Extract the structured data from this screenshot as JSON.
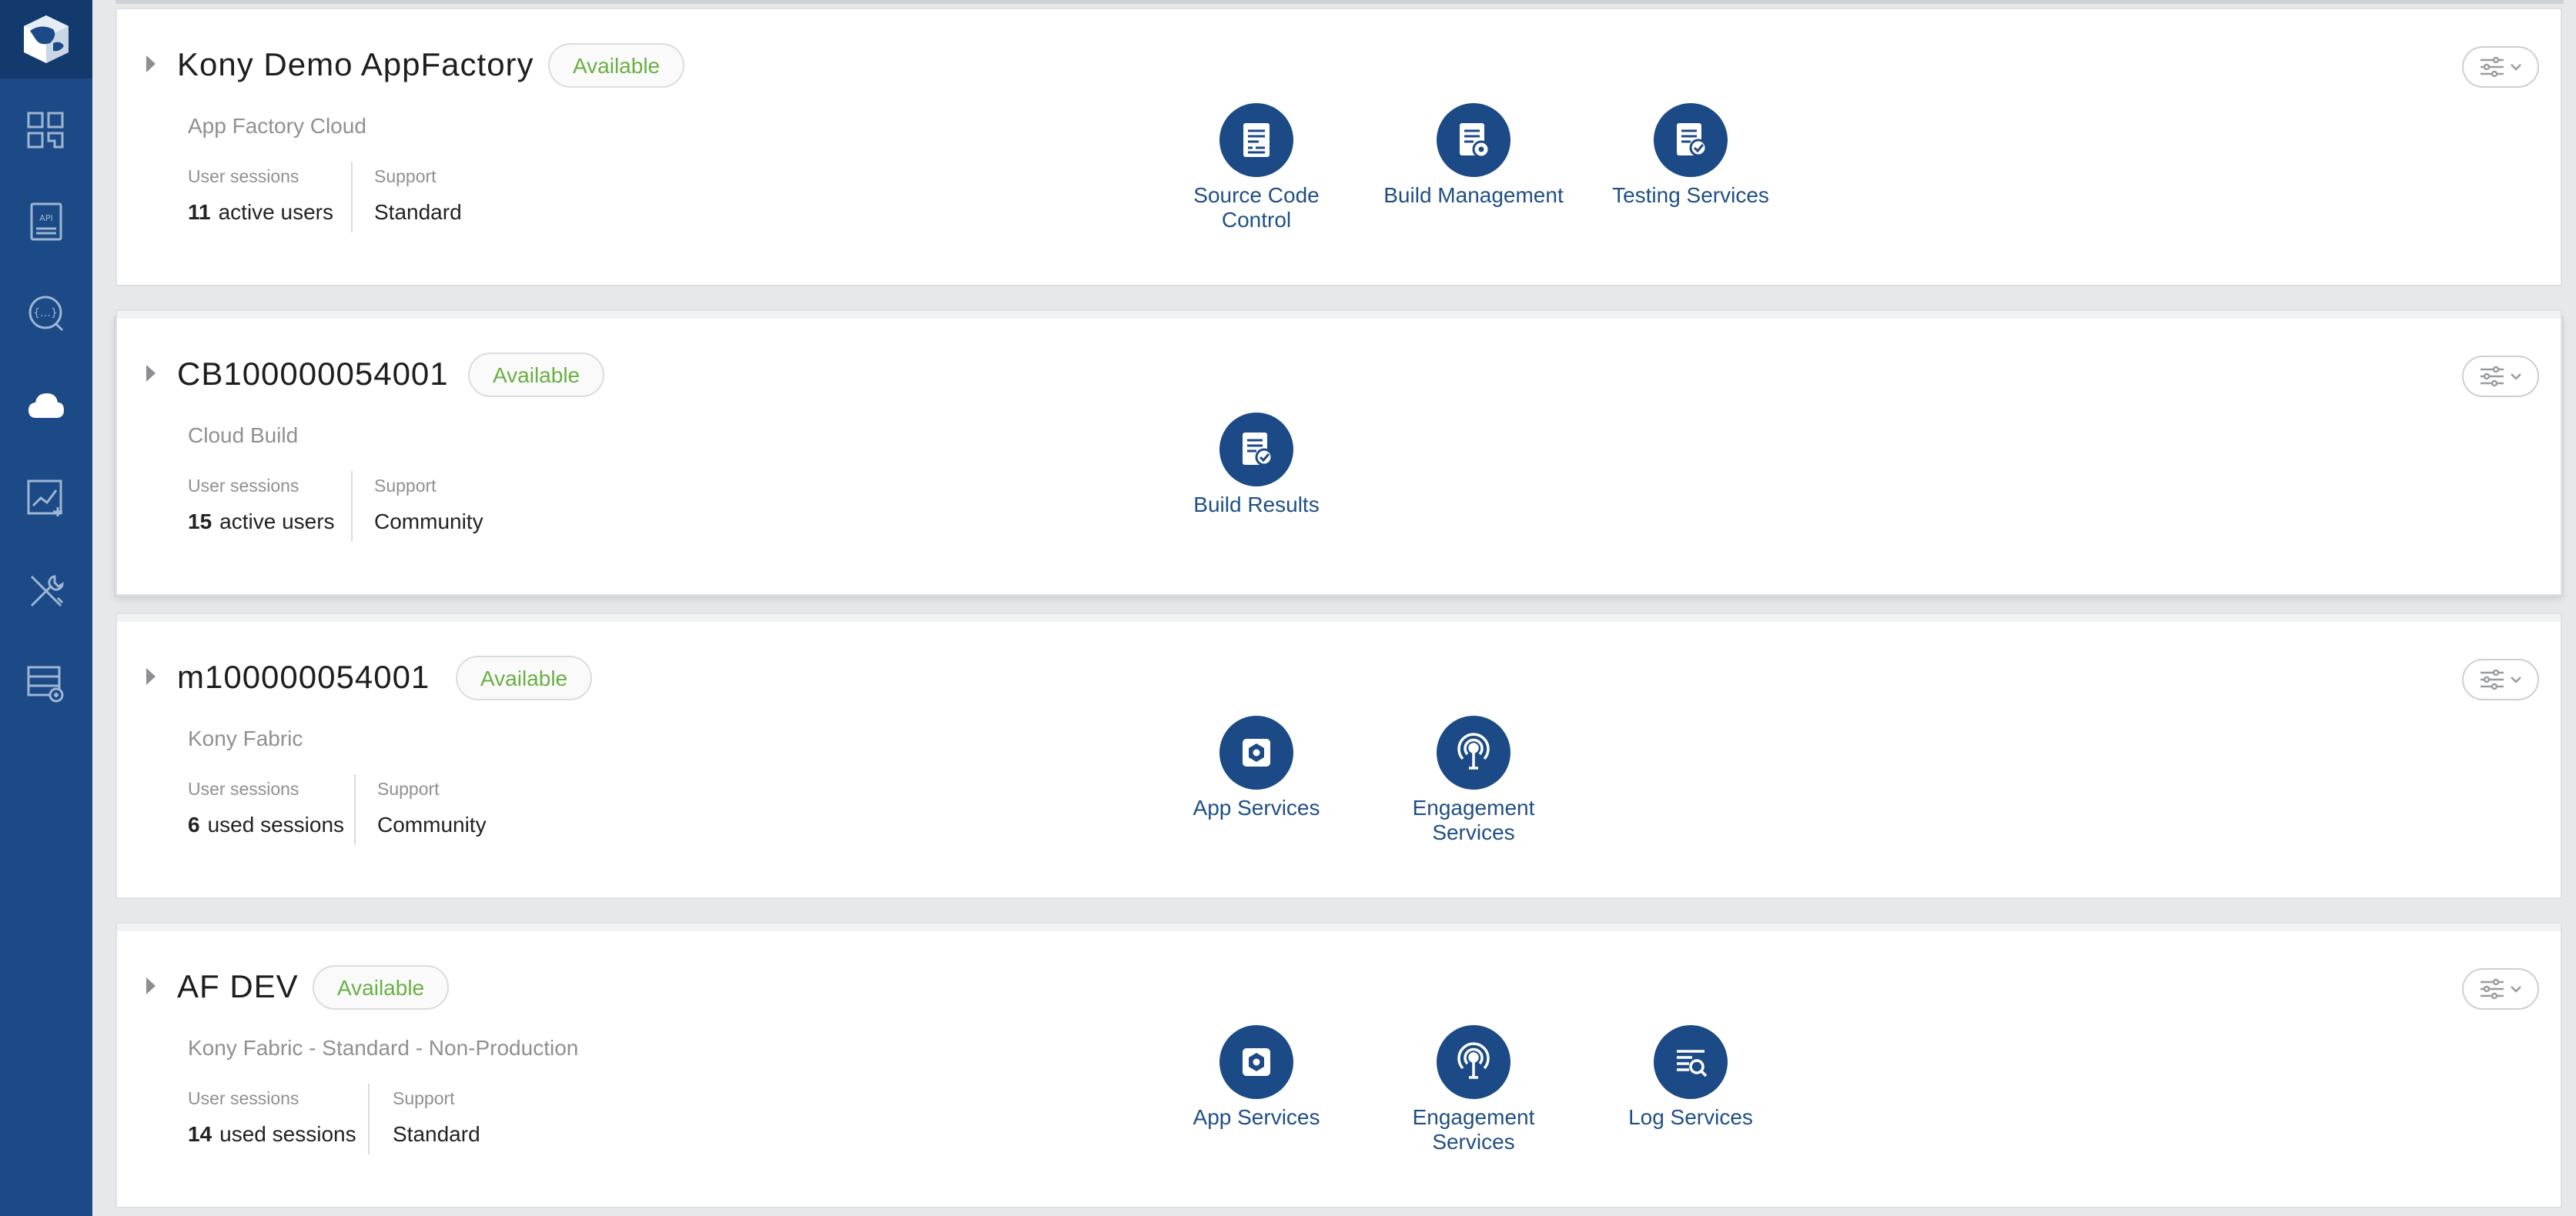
{
  "sidebar": {
    "items": [
      {
        "name": "dashboard-icon"
      },
      {
        "name": "api-icon"
      },
      {
        "name": "chat-icon"
      },
      {
        "name": "cloud-icon",
        "active": true
      },
      {
        "name": "analytics-icon"
      },
      {
        "name": "tools-icon"
      },
      {
        "name": "server-icon"
      }
    ]
  },
  "colors": {
    "sidebar": "#1b4a86",
    "accent": "#1f4f86",
    "available": "#69b043"
  },
  "clouds": [
    {
      "title": "Kony Demo AppFactory",
      "status": "Available",
      "subtitle": "App Factory Cloud",
      "sessions_label": "User sessions",
      "sessions_count": "11",
      "sessions_unit": "active users",
      "support_label": "Support",
      "support_value": "Standard",
      "services": [
        {
          "label": "Source Code Control",
          "icon": "source-code-icon"
        },
        {
          "label": "Build Management",
          "icon": "build-management-icon"
        },
        {
          "label": "Testing Services",
          "icon": "testing-services-icon"
        }
      ]
    },
    {
      "title": "CB100000054001",
      "status": "Available",
      "subtitle": "Cloud Build",
      "sessions_label": "User sessions",
      "sessions_count": "15",
      "sessions_unit": "active users",
      "support_label": "Support",
      "support_value": "Community",
      "services": [
        {
          "label": "Build Results",
          "icon": "build-results-icon"
        }
      ]
    },
    {
      "title": "m100000054001",
      "status": "Available",
      "subtitle": "Kony Fabric",
      "sessions_label": "User sessions",
      "sessions_count": "6",
      "sessions_unit": "used sessions",
      "support_label": "Support",
      "support_value": "Community",
      "services": [
        {
          "label": "App Services",
          "icon": "app-services-icon"
        },
        {
          "label": "Engagement Services",
          "icon": "engagement-services-icon"
        }
      ]
    },
    {
      "title": "AF DEV",
      "status": "Available",
      "subtitle": "Kony Fabric - Standard - Non-Production",
      "sessions_label": "User sessions",
      "sessions_count": "14",
      "sessions_unit": "used sessions",
      "support_label": "Support",
      "support_value": "Standard",
      "services": [
        {
          "label": "App Services",
          "icon": "app-services-icon"
        },
        {
          "label": "Engagement Services",
          "icon": "engagement-services-icon"
        },
        {
          "label": "Log Services",
          "icon": "log-services-icon"
        }
      ]
    }
  ]
}
